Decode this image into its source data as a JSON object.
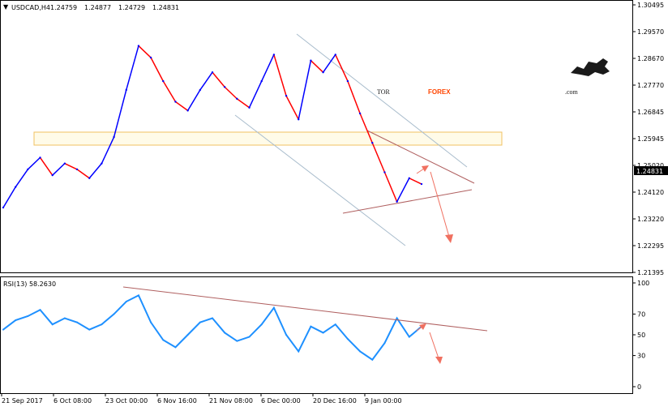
{
  "header": {
    "symbol": "USDCAD,H4",
    "open": "1.24759",
    "high": "1.24877",
    "low": "1.24729",
    "close": "1.24831"
  },
  "logo": {
    "part1": "TOR",
    "part2": "FOREX",
    "part3": ".com",
    "color_dark": "#1a1a1a",
    "color_accent": "#ff4500"
  },
  "rsi": {
    "label": "RSI(13) 58.2630",
    "levels": [
      "100",
      "70",
      "50",
      "30",
      "0"
    ]
  },
  "colors": {
    "up_candle": "#0000ff",
    "down_candle": "#ff0000",
    "rsi_line": "#1e90ff",
    "trend_line": "#b06060",
    "channel_line": "#a8bccc",
    "zone_border": "#f0c060",
    "arrow": "#f07060",
    "price_tag_bg": "#000000"
  },
  "chart_data": {
    "type": "line",
    "title": "USDCAD,H4",
    "y_ticks": [
      "1.30495",
      "1.29570",
      "1.28670",
      "1.27770",
      "1.26845",
      "1.25945",
      "1.25020",
      "1.24120",
      "1.23220",
      "1.22295",
      "1.21395"
    ],
    "ylim": [
      1.21395,
      1.30495
    ],
    "current_price": "1.24831",
    "x_ticks": [
      "21 Sep 2017",
      "6 Oct 08:00",
      "23 Oct 00:00",
      "6 Nov 16:00",
      "21 Nov 08:00",
      "6 Dec 00:00",
      "20 Dec 16:00",
      "9 Jan 00:00"
    ],
    "series": [
      {
        "name": "price",
        "x": [
          0,
          4,
          8,
          12,
          16,
          20,
          24,
          28,
          32,
          36,
          40,
          44,
          48,
          52,
          56,
          60,
          64,
          68,
          72,
          76,
          80,
          84,
          88,
          92,
          96,
          100,
          104,
          108,
          112,
          116,
          120,
          124,
          128,
          132,
          136
        ],
        "values": [
          1.236,
          1.243,
          1.249,
          1.253,
          1.247,
          1.251,
          1.249,
          1.246,
          1.251,
          1.26,
          1.276,
          1.291,
          1.287,
          1.279,
          1.272,
          1.269,
          1.276,
          1.282,
          1.277,
          1.273,
          1.27,
          1.279,
          1.288,
          1.274,
          1.266,
          1.286,
          1.282,
          1.288,
          1.279,
          1.268,
          1.258,
          1.248,
          1.238,
          1.246,
          1.244
        ]
      },
      {
        "name": "RSI(13)",
        "x": [
          0,
          4,
          8,
          12,
          16,
          20,
          24,
          28,
          32,
          36,
          40,
          44,
          48,
          52,
          56,
          60,
          64,
          68,
          72,
          76,
          80,
          84,
          88,
          92,
          96,
          100,
          104,
          108,
          112,
          116,
          120,
          124,
          128,
          132,
          136
        ],
        "values": [
          55,
          64,
          68,
          74,
          60,
          66,
          62,
          55,
          60,
          70,
          82,
          88,
          62,
          45,
          38,
          50,
          62,
          66,
          52,
          44,
          48,
          60,
          76,
          50,
          34,
          58,
          52,
          60,
          46,
          34,
          26,
          42,
          66,
          48,
          58
        ]
      }
    ]
  }
}
